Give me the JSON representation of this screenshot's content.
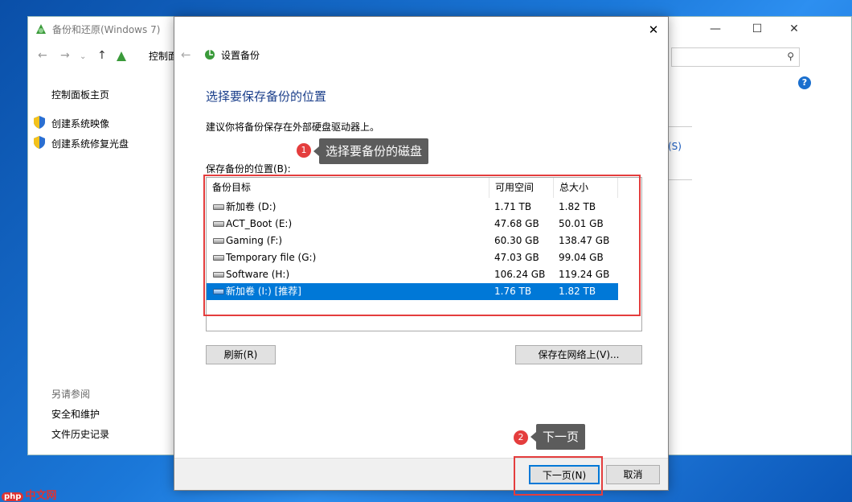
{
  "background_window": {
    "title": "备份和还原(Windows 7)",
    "address_crumb": "控制面",
    "sidebar": {
      "home": "控制面板主页",
      "links": [
        "创建系统映像",
        "创建系统修复光盘"
      ],
      "see_also_heading": "另请参阅",
      "see_also_links": [
        "安全和维护",
        "文件历史记录"
      ]
    },
    "right_partial_link": "(S)"
  },
  "dialog": {
    "title": "设置备份",
    "heading": "选择要保存备份的位置",
    "description": "建议你将备份保存在外部硬盘驱动器上。",
    "list_label": "保存备份的位置(B):",
    "columns": [
      "备份目标",
      "可用空间",
      "总大小"
    ],
    "rows": [
      {
        "name": "新加卷 (D:)",
        "free": "1.71 TB",
        "total": "1.82 TB",
        "selected": false
      },
      {
        "name": "ACT_Boot (E:)",
        "free": "47.68 GB",
        "total": "50.01 GB",
        "selected": false
      },
      {
        "name": "Gaming (F:)",
        "free": "60.30 GB",
        "total": "138.47 GB",
        "selected": false
      },
      {
        "name": "Temporary file (G:)",
        "free": "47.03 GB",
        "total": "99.04 GB",
        "selected": false
      },
      {
        "name": "Software (H:)",
        "free": "106.24 GB",
        "total": "119.24 GB",
        "selected": false
      },
      {
        "name": "新加卷 (I:) [推荐]",
        "free": "1.76 TB",
        "total": "1.82 TB",
        "selected": true
      }
    ],
    "refresh_button": "刷新(R)",
    "save_network_button": "保存在网络上(V)...",
    "next_button": "下一页(N)",
    "cancel_button": "取消"
  },
  "annotations": [
    {
      "number": "1",
      "text": "选择要备份的磁盘"
    },
    {
      "number": "2",
      "text": "下一页"
    }
  ],
  "watermark": {
    "badge": "php",
    "text": "中文网"
  },
  "colors": {
    "selection": "#0078d7",
    "annotation_red": "#e43d3d",
    "tooltip": "#5c5c5c",
    "heading_blue": "#1a3e8a"
  }
}
